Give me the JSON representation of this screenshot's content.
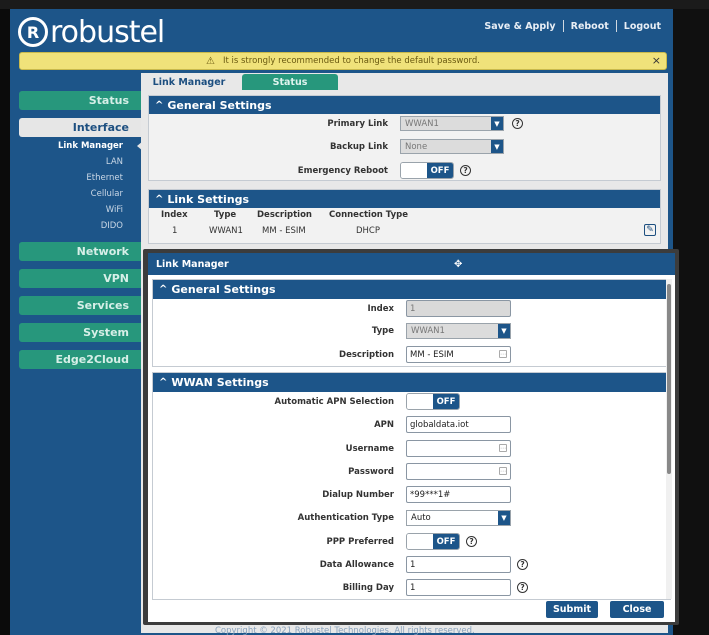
{
  "header": {
    "logo_mark": "R",
    "logo_text": "robustel",
    "links": [
      "Save & Apply",
      "Reboot",
      "Logout"
    ]
  },
  "warning": {
    "icon": "warning-triangle-icon",
    "text": "It is strongly recommended to change the default password.",
    "close": "×"
  },
  "nav": {
    "items": [
      "Status",
      "Interface",
      "Network",
      "VPN",
      "Services",
      "System",
      "Edge2Cloud"
    ],
    "active": "Interface",
    "sub_items": [
      "Link Manager",
      "LAN",
      "Ethernet",
      "Cellular",
      "WiFi",
      "DIDO"
    ],
    "active_sub": "Link Manager"
  },
  "tabs": [
    "Link Manager",
    "Status"
  ],
  "general": {
    "title": "General Settings",
    "primary_label": "Primary Link",
    "primary_value": "WWAN1",
    "backup_label": "Backup Link",
    "backup_value": "None",
    "reboot_label": "Emergency Reboot",
    "reboot_state": "OFF"
  },
  "link_settings": {
    "title": "Link Settings",
    "columns": [
      "Index",
      "Type",
      "Description",
      "Connection Type"
    ],
    "rows": [
      [
        "1",
        "WWAN1",
        "MM - ESIM",
        "DHCP"
      ]
    ]
  },
  "modal": {
    "title": "Link Manager",
    "general_title": "General Settings",
    "index_label": "Index",
    "index_value": "1",
    "type_label": "Type",
    "type_value": "WWAN1",
    "desc_label": "Description",
    "desc_value": "MM - ESIM",
    "wwan_title": "WWAN Settings",
    "auto_apn_label": "Automatic APN Selection",
    "auto_apn_state": "OFF",
    "apn_label": "APN",
    "apn_value": "globaldata.iot",
    "username_label": "Username",
    "username_value": "",
    "password_label": "Password",
    "password_value": "",
    "dialup_label": "Dialup Number",
    "dialup_value": "*99***1#",
    "auth_label": "Authentication Type",
    "auth_value": "Auto",
    "ppp_label": "PPP Preferred",
    "ppp_state": "OFF",
    "data_label": "Data Allowance",
    "data_value": "1",
    "billing_label": "Billing Day",
    "billing_value": "1",
    "submit": "Submit",
    "close": "Close"
  },
  "footer": {
    "copyright": "Copyright © 2021 Robustel Technologies. All rights reserved."
  },
  "colors": {
    "brand_blue": "#1d5589",
    "nav_green": "#27977c",
    "warning_yellow": "#f0e27a"
  }
}
